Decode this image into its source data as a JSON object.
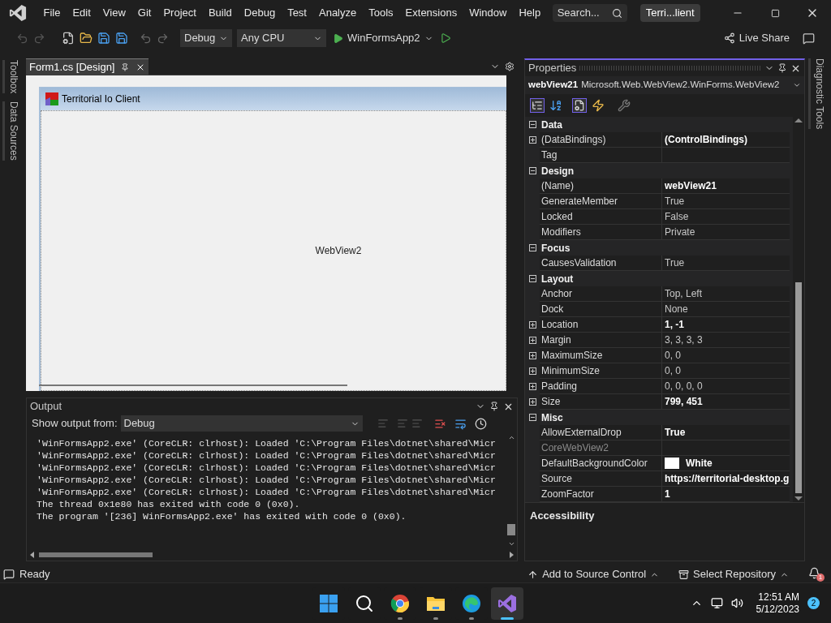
{
  "title_bar": {
    "menus": [
      "File",
      "Edit",
      "View",
      "Git",
      "Project",
      "Build",
      "Debug",
      "Test",
      "Analyze",
      "Tools",
      "Extensions",
      "Window",
      "Help"
    ],
    "search": {
      "placeholder": "Search..."
    },
    "solution_title": "Terri...lient"
  },
  "toolbar": {
    "configuration": "Debug",
    "platform": "Any CPU",
    "startup": "WinFormsApp2",
    "live_share": "Live Share"
  },
  "left_tabs": [
    "Toolbox",
    "Data Sources"
  ],
  "right_tabs": [
    "Diagnostic Tools"
  ],
  "document_tabs": [
    {
      "label": "Form1.cs [Design]",
      "selected": true
    }
  ],
  "designer": {
    "form_title": "Territorial Io Client",
    "control_label": "WebView2"
  },
  "output": {
    "title": "Output",
    "show_from_label": "Show output from:",
    "source": "Debug",
    "lines": [
      "'WinFormsApp2.exe' (CoreCLR: clrhost): Loaded 'C:\\Program Files\\dotnet\\shared\\Micr",
      "'WinFormsApp2.exe' (CoreCLR: clrhost): Loaded 'C:\\Program Files\\dotnet\\shared\\Micr",
      "'WinFormsApp2.exe' (CoreCLR: clrhost): Loaded 'C:\\Program Files\\dotnet\\shared\\Micr",
      "'WinFormsApp2.exe' (CoreCLR: clrhost): Loaded 'C:\\Program Files\\dotnet\\shared\\Micr",
      "'WinFormsApp2.exe' (CoreCLR: clrhost): Loaded 'C:\\Program Files\\dotnet\\shared\\Micr",
      "The thread 0x1e80 has exited with code 0 (0x0).",
      "The program '[236] WinFormsApp2.exe' has exited with code 0 (0x0)."
    ]
  },
  "properties": {
    "title": "Properties",
    "object_name": "webView21",
    "object_type": "Microsoft.Web.WebView2.WinForms.WebView2",
    "rows": [
      {
        "kind": "category",
        "name": "Data",
        "expanded": true
      },
      {
        "kind": "property",
        "name": "(DataBindings)",
        "value": "(ControlBindings)",
        "bold": true,
        "expandable": true,
        "disabled": false
      },
      {
        "kind": "property",
        "name": "Tag",
        "value": "",
        "expandable": false,
        "disabled": false
      },
      {
        "kind": "category",
        "name": "Design",
        "expanded": true
      },
      {
        "kind": "property",
        "name": "(Name)",
        "value": "webView21",
        "bold": true,
        "expandable": false,
        "disabled": false
      },
      {
        "kind": "property",
        "name": "GenerateMember",
        "value": "True",
        "bold": false,
        "expandable": false,
        "disabled": false
      },
      {
        "kind": "property",
        "name": "Locked",
        "value": "False",
        "bold": false,
        "expandable": false,
        "disabled": false
      },
      {
        "kind": "property",
        "name": "Modifiers",
        "value": "Private",
        "bold": false,
        "expandable": false,
        "disabled": false
      },
      {
        "kind": "category",
        "name": "Focus",
        "expanded": true
      },
      {
        "kind": "property",
        "name": "CausesValidation",
        "value": "True",
        "bold": false,
        "expandable": false,
        "disabled": false
      },
      {
        "kind": "category",
        "name": "Layout",
        "expanded": true
      },
      {
        "kind": "property",
        "name": "Anchor",
        "value": "Top, Left",
        "bold": false,
        "expandable": false,
        "disabled": false
      },
      {
        "kind": "property",
        "name": "Dock",
        "value": "None",
        "bold": false,
        "expandable": false,
        "disabled": false
      },
      {
        "kind": "property",
        "name": "Location",
        "value": "1, -1",
        "bold": true,
        "expandable": true,
        "disabled": false
      },
      {
        "kind": "property",
        "name": "Margin",
        "value": "3, 3, 3, 3",
        "bold": false,
        "expandable": true,
        "disabled": false
      },
      {
        "kind": "property",
        "name": "MaximumSize",
        "value": "0, 0",
        "bold": false,
        "expandable": true,
        "disabled": false
      },
      {
        "kind": "property",
        "name": "MinimumSize",
        "value": "0, 0",
        "bold": false,
        "expandable": true,
        "disabled": false
      },
      {
        "kind": "property",
        "name": "Padding",
        "value": "0, 0, 0, 0",
        "bold": false,
        "expandable": true,
        "disabled": false
      },
      {
        "kind": "property",
        "name": "Size",
        "value": "799, 451",
        "bold": true,
        "expandable": true,
        "disabled": false
      },
      {
        "kind": "category",
        "name": "Misc",
        "expanded": true
      },
      {
        "kind": "property",
        "name": "AllowExternalDrop",
        "value": "True",
        "bold": true,
        "expandable": false,
        "disabled": false
      },
      {
        "kind": "property",
        "name": "CoreWebView2",
        "value": "",
        "expandable": false,
        "disabled": true
      },
      {
        "kind": "color",
        "name": "DefaultBackgroundColor",
        "value": "White",
        "color": "#ffffff",
        "bold": true,
        "expandable": false,
        "disabled": false
      },
      {
        "kind": "property",
        "name": "Source",
        "value": "https://territorial-desktop.g",
        "bold": true,
        "expandable": false,
        "disabled": false
      },
      {
        "kind": "property",
        "name": "ZoomFactor",
        "value": "1",
        "bold": true,
        "expandable": false,
        "disabled": false
      }
    ],
    "description": "Accessibility"
  },
  "status_bar": {
    "status": "Ready",
    "source_control": "Add to Source Control",
    "repository": "Select Repository",
    "notifications": "1"
  },
  "taskbar": {
    "apps": [
      {
        "kind": "start",
        "selected": false
      },
      {
        "kind": "search",
        "selected": false
      },
      {
        "kind": "chrome",
        "selected": false
      },
      {
        "kind": "files",
        "selected": false
      },
      {
        "kind": "edge",
        "selected": false
      },
      {
        "kind": "visualstudio",
        "selected": true
      }
    ],
    "time": "12:51 AM",
    "date": "5/12/2023",
    "notification_count": "2"
  }
}
